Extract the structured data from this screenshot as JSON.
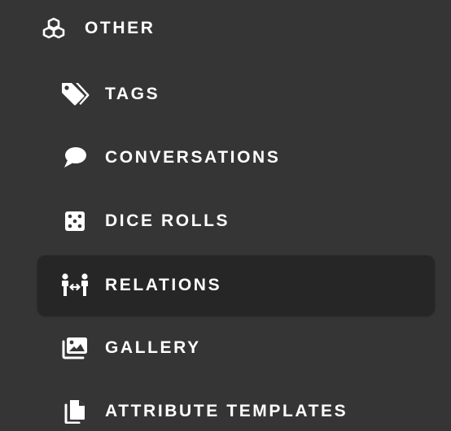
{
  "section": {
    "label": "OTHER",
    "icon": "cubes-icon"
  },
  "items": [
    {
      "label": "TAGS",
      "icon": "tags-icon",
      "active": false
    },
    {
      "label": "CONVERSATIONS",
      "icon": "speech-bubble-icon",
      "active": false
    },
    {
      "label": "DICE ROLLS",
      "icon": "dice-icon",
      "active": false
    },
    {
      "label": "RELATIONS",
      "icon": "people-arrows-icon",
      "active": true
    },
    {
      "label": "GALLERY",
      "icon": "images-icon",
      "active": false
    },
    {
      "label": "ATTRIBUTE TEMPLATES",
      "icon": "copy-icon",
      "active": false
    }
  ],
  "colors": {
    "background": "#353535",
    "active_background": "#262626",
    "text": "#ffffff"
  }
}
